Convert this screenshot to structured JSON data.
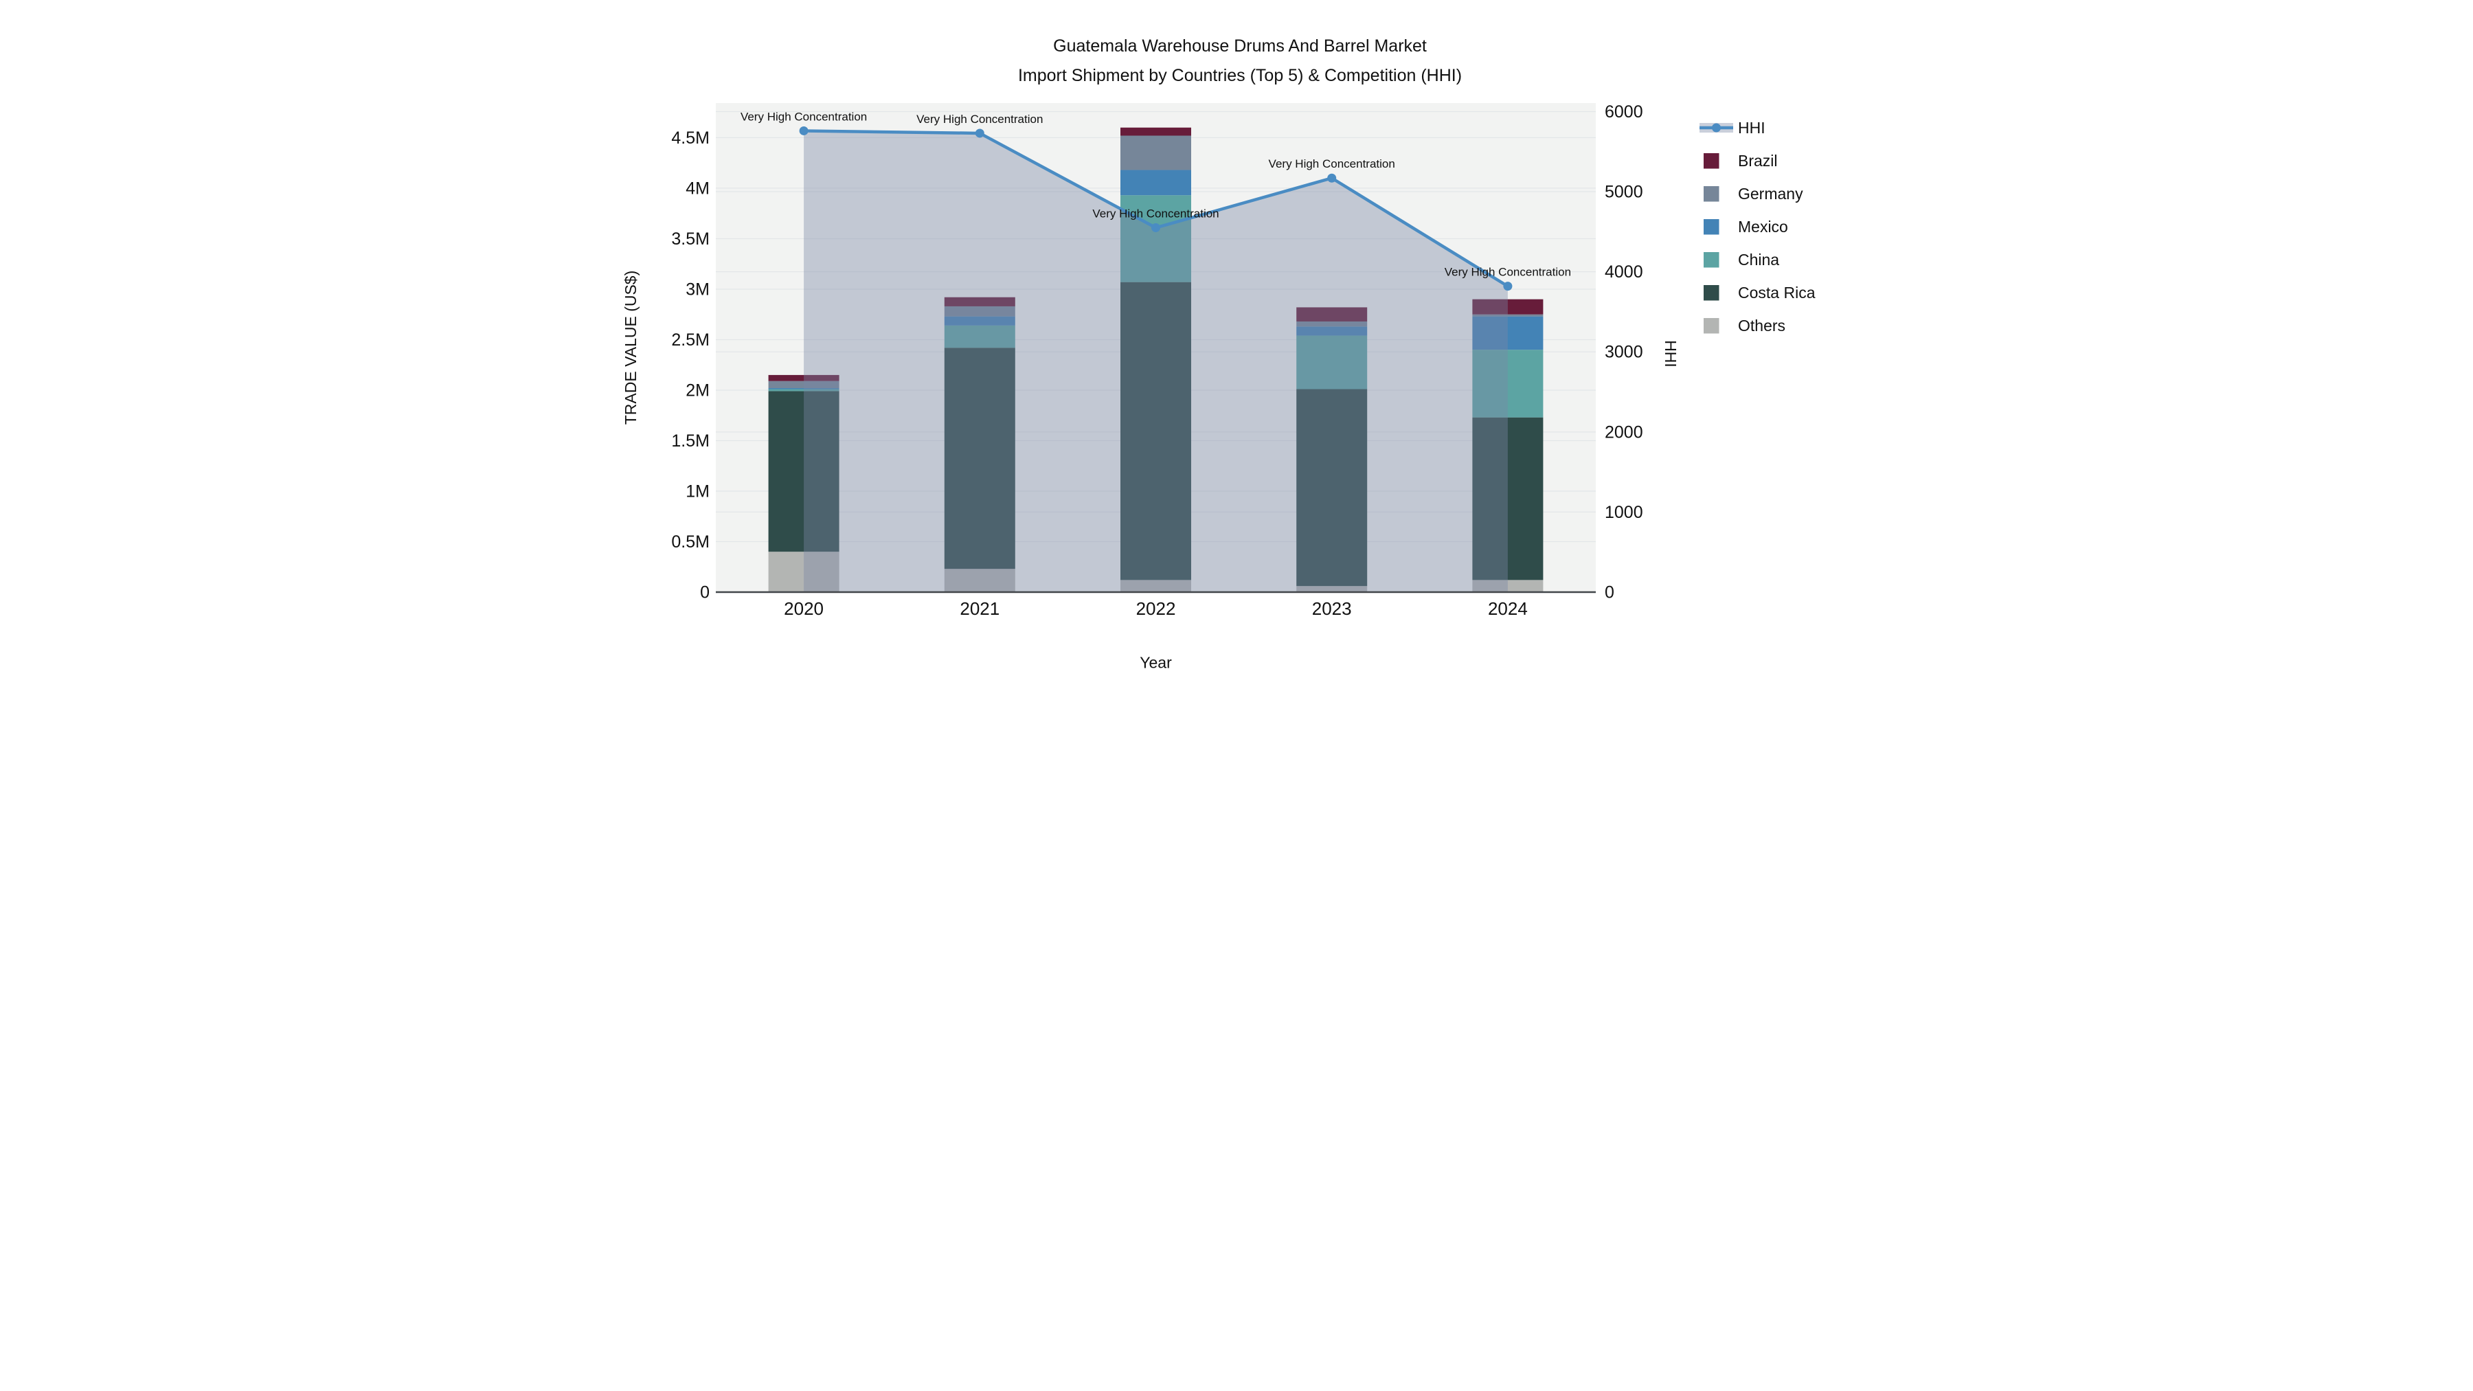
{
  "title": {
    "line1": "Guatemala Warehouse Drums And Barrel Market",
    "line2": "Import Shipment by Countries (Top 5) & Competition (HHI)"
  },
  "axes": {
    "x": {
      "title": "Year",
      "categories": [
        "2020",
        "2021",
        "2022",
        "2023",
        "2024"
      ]
    },
    "y_left": {
      "title": "TRADE VALUE (US$)",
      "tick_values": [
        0,
        0.5,
        1,
        1.5,
        2,
        2.5,
        3,
        3.5,
        4,
        4.5
      ],
      "tick_labels": [
        "0",
        "0.5M",
        "1M",
        "1.5M",
        "2M",
        "2.5M",
        "3M",
        "3.5M",
        "4M",
        "4.5M"
      ],
      "range": [
        0,
        4.843
      ],
      "unit": "millions of US$"
    },
    "y_right": {
      "title": "HHI",
      "tick_values": [
        0,
        1000,
        2000,
        3000,
        4000,
        5000,
        6000
      ],
      "tick_labels": [
        "0",
        "1000",
        "2000",
        "3000",
        "4000",
        "5000",
        "6000"
      ],
      "range": [
        0,
        6107
      ]
    }
  },
  "chart_data": {
    "type": "combo-stacked-bar-line",
    "categories": [
      "2020",
      "2021",
      "2022",
      "2023",
      "2024"
    ],
    "bar_unit": "M US$ (trade value, millions)",
    "series": [
      {
        "name": "Brazil",
        "color": "#671c3a",
        "values": [
          0.06,
          0.09,
          0.08,
          0.14,
          0.15
        ]
      },
      {
        "name": "Germany",
        "color": "#768699",
        "values": [
          0.07,
          0.1,
          0.34,
          0.05,
          0.02
        ]
      },
      {
        "name": "Mexico",
        "color": "#4383b6",
        "values": [
          0.01,
          0.09,
          0.25,
          0.09,
          0.33
        ]
      },
      {
        "name": "China",
        "color": "#5ca4a3",
        "values": [
          0.02,
          0.22,
          0.86,
          0.53,
          0.67
        ]
      },
      {
        "name": "Costa Rica",
        "color": "#2f4c4a",
        "values": [
          1.59,
          2.19,
          2.95,
          1.95,
          1.61
        ]
      },
      {
        "name": "Others",
        "color": "#b3b5b3",
        "values": [
          0.4,
          0.23,
          0.12,
          0.06,
          0.12
        ]
      }
    ],
    "stack_order_bottom_to_top": [
      "Others",
      "Costa Rica",
      "China",
      "Mexico",
      "Germany",
      "Brazil"
    ],
    "bar_totals": [
      2.15,
      2.92,
      4.6,
      2.82,
      2.9
    ],
    "line_series": {
      "name": "HHI",
      "axis": "right",
      "color": "#4a8cc3",
      "area_fill": "rgba(122,136,164,0.40)",
      "values": [
        5760,
        5730,
        4550,
        5170,
        3820
      ]
    },
    "annotations": [
      {
        "category": "2020",
        "text": "Very High Concentration"
      },
      {
        "category": "2021",
        "text": "Very High Concentration"
      },
      {
        "category": "2022",
        "text": "Very High Concentration"
      },
      {
        "category": "2023",
        "text": "Very High Concentration"
      },
      {
        "category": "2024",
        "text": "Very High Concentration"
      }
    ],
    "legend_position": "right",
    "grid": true,
    "plot_background": "#f2f3f2",
    "grid_color": "#e3e6e8",
    "axis_line_color": "#42464a"
  }
}
